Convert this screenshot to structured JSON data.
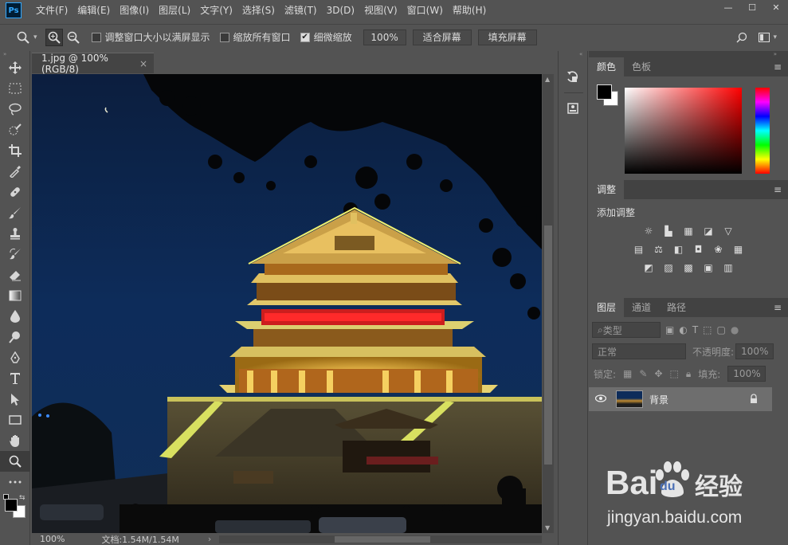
{
  "app": {
    "logo": "Ps"
  },
  "menu": [
    "文件(F)",
    "编辑(E)",
    "图像(I)",
    "图层(L)",
    "文字(Y)",
    "选择(S)",
    "滤镜(T)",
    "3D(D)",
    "视图(V)",
    "窗口(W)",
    "帮助(H)"
  ],
  "window_controls": {
    "minimize": "—",
    "maximize": "☐",
    "close": "✕"
  },
  "options": {
    "fit_windows_label": "调整窗口大小以满屏显示",
    "zoom_all_label": "缩放所有窗口",
    "scrubby_zoom_label": "细微缩放",
    "scrubby_zoom_checked": true,
    "zoom_value": "100%",
    "fit_screen": "适合屏幕",
    "fill_screen": "填充屏幕"
  },
  "document": {
    "tab_title": "1.jpg @ 100%(RGB/8)",
    "close": "×"
  },
  "status": {
    "zoom": "100%",
    "doc_info": "文档:1.54M/1.54M",
    "arrow": "›"
  },
  "panels": {
    "color_tab": "颜色",
    "swatches_tab": "色板",
    "adjustments_tab": "调整",
    "add_adjustment": "添加调整",
    "layers_tab": "图层",
    "channels_tab": "通道",
    "paths_tab": "路径",
    "filter_kind": "类型",
    "blend_mode": "正常",
    "opacity_label": "不透明度:",
    "opacity_value": "100%",
    "lock_label": "锁定:",
    "fill_label": "填充:",
    "fill_value": "100%",
    "layer_name": "背景"
  },
  "watermark": {
    "brand": "Bai",
    "brand2": "du",
    "jingyan": "经验",
    "url": "jingyan.baidu.com"
  },
  "colors": {
    "bg": "#535353",
    "panel_dark": "#424242",
    "accent": "#31a8ff"
  }
}
